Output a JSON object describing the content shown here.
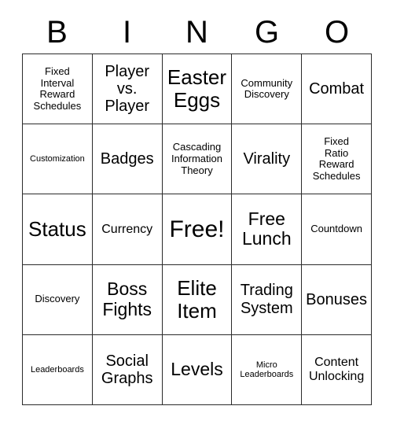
{
  "card": {
    "header_letters": [
      "B",
      "I",
      "N",
      "G",
      "O"
    ],
    "background_color": "#ffffff",
    "text_color": "#000000",
    "border_color": "#2b2b2b",
    "rows": 5,
    "columns": 5,
    "cells": [
      [
        {
          "text": "Fixed\nInterval\nReward\nSchedules",
          "size": "xs",
          "free": false
        },
        {
          "text": "Player\nvs.\nPlayer",
          "size": "md",
          "free": false
        },
        {
          "text": "Easter\nEggs",
          "size": "xl",
          "free": false
        },
        {
          "text": "Community\nDiscovery",
          "size": "xs",
          "free": false
        },
        {
          "text": "Combat",
          "size": "md",
          "free": false
        }
      ],
      [
        {
          "text": "Customization",
          "size": "xxs",
          "free": false
        },
        {
          "text": "Badges",
          "size": "md",
          "free": false
        },
        {
          "text": "Cascading\nInformation\nTheory",
          "size": "xs",
          "free": false
        },
        {
          "text": "Virality",
          "size": "md",
          "free": false
        },
        {
          "text": "Fixed\nRatio\nReward\nSchedules",
          "size": "xs",
          "free": false
        }
      ],
      [
        {
          "text": "Status",
          "size": "xl",
          "free": false
        },
        {
          "text": "Currency",
          "size": "sm",
          "free": false
        },
        {
          "text": "Free!",
          "size": "xxl",
          "free": true
        },
        {
          "text": "Free\nLunch",
          "size": "lg",
          "free": false
        },
        {
          "text": "Countdown",
          "size": "xs",
          "free": false
        }
      ],
      [
        {
          "text": "Discovery",
          "size": "xs",
          "free": false
        },
        {
          "text": "Boss\nFights",
          "size": "lg",
          "free": false
        },
        {
          "text": "Elite\nItem",
          "size": "xl",
          "free": false
        },
        {
          "text": "Trading\nSystem",
          "size": "md",
          "free": false
        },
        {
          "text": "Bonuses",
          "size": "md",
          "free": false
        }
      ],
      [
        {
          "text": "Leaderboards",
          "size": "xxs",
          "free": false
        },
        {
          "text": "Social\nGraphs",
          "size": "md",
          "free": false
        },
        {
          "text": "Levels",
          "size": "lg",
          "free": false
        },
        {
          "text": "Micro\nLeaderboards",
          "size": "xxs",
          "free": false
        },
        {
          "text": "Content\nUnlocking",
          "size": "sm",
          "free": false
        }
      ]
    ]
  }
}
